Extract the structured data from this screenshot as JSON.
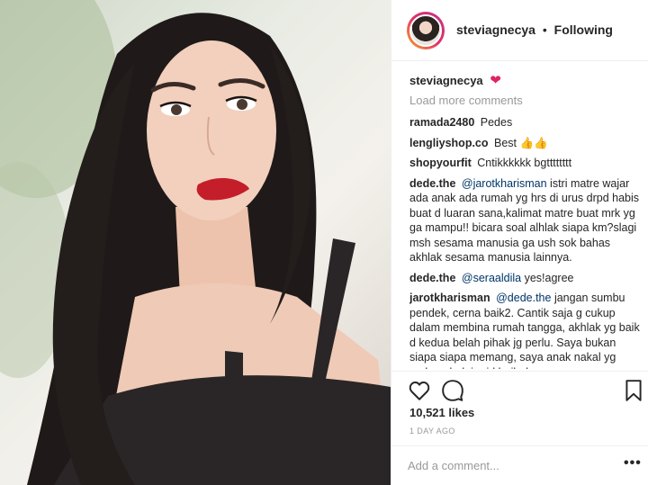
{
  "post": {
    "username": "steviagnecya",
    "separator": "•",
    "follow_status": "Following",
    "caption_user": "steviagnecya",
    "caption_emoji": "❤",
    "load_more": "Load more comments",
    "comments": [
      {
        "user": "ramada2480",
        "text": "Pedes"
      },
      {
        "user": "lengliyshop.co",
        "text": "Best",
        "emoji": "👍👍"
      },
      {
        "user": "shopyourfit",
        "text": "Cntikkkkkk bgtttttttt"
      },
      {
        "user": "dede.the",
        "mention": "@jarotkharisman",
        "text": "istri matre wajar ada anak ada rumah yg hrs di urus drpd habis buat d luaran sana,kalimat matre buat mrk yg ga mampu!! bicara soal alhlak siapa km?slagi msh sesama manusia ga ush sok bahas akhlak sesama manusia lainnya."
      },
      {
        "user": "dede.the",
        "mention": "@seraaldila",
        "text": "yes!agree"
      },
      {
        "user": "jarotkharisman",
        "mention": "@dede.the",
        "text": "jangan sumbu pendek, cerna baik2. Cantik saja g cukup dalam membina rumah tangga, akhlak yg baik d kedua belah pihak jg perlu. Saya bukan siapa siapa memang, saya anak nakal yg sedang belajar jd baik dan"
      }
    ],
    "likes": "10,521 likes",
    "timestamp": "1 DAY AGO",
    "add_comment_placeholder": "Add a comment...",
    "more_options": "•••",
    "icons": {
      "like": "heart-outline-icon",
      "comment": "speech-bubble-icon",
      "save": "bookmark-icon"
    },
    "colors": {
      "link": "#003569",
      "muted": "#999999",
      "text": "#262626",
      "heart_emoji": "#e0245e"
    }
  }
}
